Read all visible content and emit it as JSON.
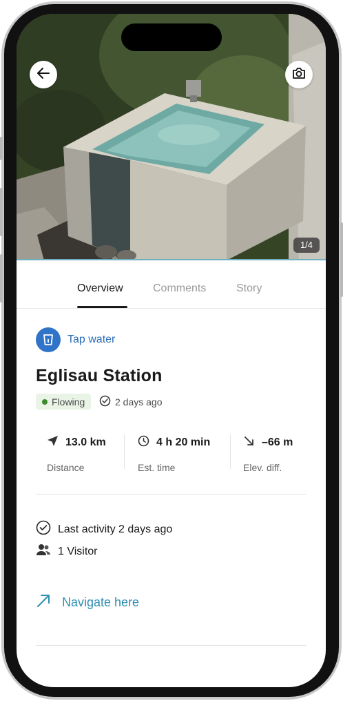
{
  "photo": {
    "counter": "1/4"
  },
  "tabs": [
    {
      "label": "Overview",
      "active": true
    },
    {
      "label": "Comments",
      "active": false
    },
    {
      "label": "Story",
      "active": false
    }
  ],
  "place": {
    "type_label": "Tap water",
    "type_icon": "water-glass-icon",
    "name": "Eglisau Station",
    "status": "Flowing",
    "status_color": "#3d8a2c",
    "verified": "2 days ago"
  },
  "stats": [
    {
      "icon": "navigation-arrow-icon",
      "value": "13.0 km",
      "label": "Distance"
    },
    {
      "icon": "clock-icon",
      "value": "4 h 20 min",
      "label": "Est. time"
    },
    {
      "icon": "descending-arrow-icon",
      "value": "–66 m",
      "label": "Elev. diff."
    }
  ],
  "activity": {
    "last_activity": "Last activity 2 days ago",
    "visitors": "1 Visitor"
  },
  "navigate": {
    "label": "Navigate here",
    "color": "#2f8fb3"
  },
  "colors": {
    "accent": "#2f74c9",
    "badge_bg": "#e9f4e6",
    "photo_bar": "#6fb0c4"
  }
}
